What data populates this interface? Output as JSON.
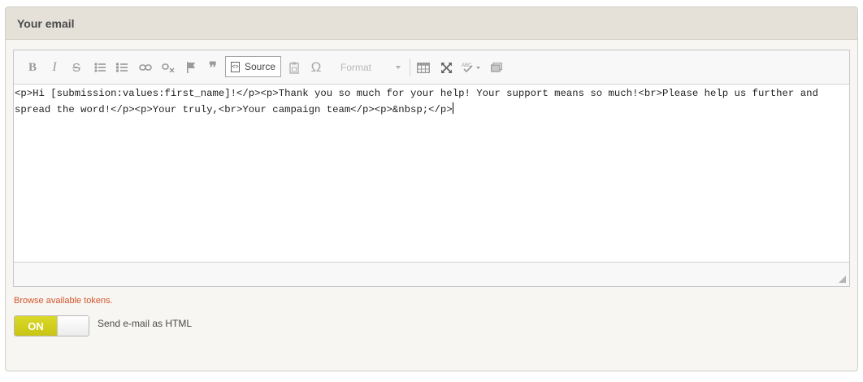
{
  "panel": {
    "title": "Your email"
  },
  "toolbar": {
    "bold_label": "B",
    "italic_label": "I",
    "strike_label": "S",
    "blockquote_label": "❞",
    "source_label": "Source",
    "format_label": "Format",
    "icons": [
      "bold-icon",
      "italic-icon",
      "strikethrough-icon",
      "bulleted-list-icon",
      "numbered-list-icon",
      "link-icon",
      "unlink-icon",
      "anchor-flag-icon",
      "blockquote-icon",
      "source-icon",
      "paste-text-icon",
      "special-character-icon",
      "table-icon",
      "maximize-icon",
      "spellcheck-icon",
      "image-icon"
    ]
  },
  "editor": {
    "content": "<p>Hi [submission:values:first_name]!</p><p>Thank you so much for your help! Your support means so much!<br>Please help us further and spread the word!</p><p>Your truly,<br>Your campaign team</p><p>&nbsp;</p>"
  },
  "tokens": {
    "link_text": "Browse available tokens."
  },
  "html_toggle": {
    "state_label": "ON",
    "label": "Send e-mail as HTML",
    "checked": true
  }
}
